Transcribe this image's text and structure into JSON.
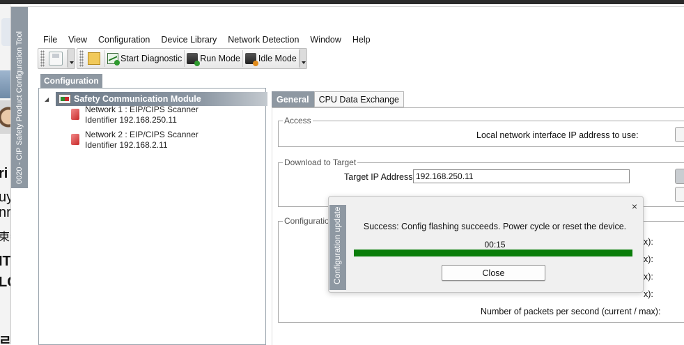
{
  "window": {
    "vertical_title": "0020 - CIP Safety Product Configuration Tool"
  },
  "menu": {
    "items": [
      "File",
      "View",
      "Configuration",
      "Device Library",
      "Network Detection",
      "Window",
      "Help"
    ]
  },
  "toolbar": {
    "start_diagnostic": "Start Diagnostic",
    "run_mode": "Run Mode",
    "idle_mode": "Idle Mode"
  },
  "section_tab": "Configuration",
  "tree": {
    "root": "Safety Communication Module",
    "children": [
      {
        "line1": "Network 1 : EIP/CIPS Scanner",
        "line2": "Identifier 192.168.250.11"
      },
      {
        "line1": "Network 2 : EIP/CIPS Scanner",
        "line2": "Identifier 192.168.2.11"
      }
    ]
  },
  "tabs": {
    "general": "General",
    "cpu_exchange": "CPU Data Exchange"
  },
  "access": {
    "legend": "Access",
    "local_ip_label": "Local network interface IP address to use:"
  },
  "download": {
    "legend": "Download to Target",
    "target_ip_label": "Target IP Address:",
    "target_ip_value": "192.168.250.11"
  },
  "config": {
    "legend": "Configuratio",
    "max_suffix": "x):",
    "packets_label": "Number of packets per second (current / max):"
  },
  "dialog": {
    "title": "Configuration update",
    "message": "Success: Config flashing succeeds. Power cycle or reset the device.",
    "time": "00:15",
    "progress_percent": 100,
    "close_label": "Close",
    "close_x": "×"
  },
  "background": {
    "chars": [
      "ri",
      "uy",
      "nr",
      "東者",
      "IT",
      "LC",
      "ㄹ"
    ]
  },
  "colors": {
    "accent_gray": "#8e98a2",
    "progress_green": "#0a7d0a"
  }
}
